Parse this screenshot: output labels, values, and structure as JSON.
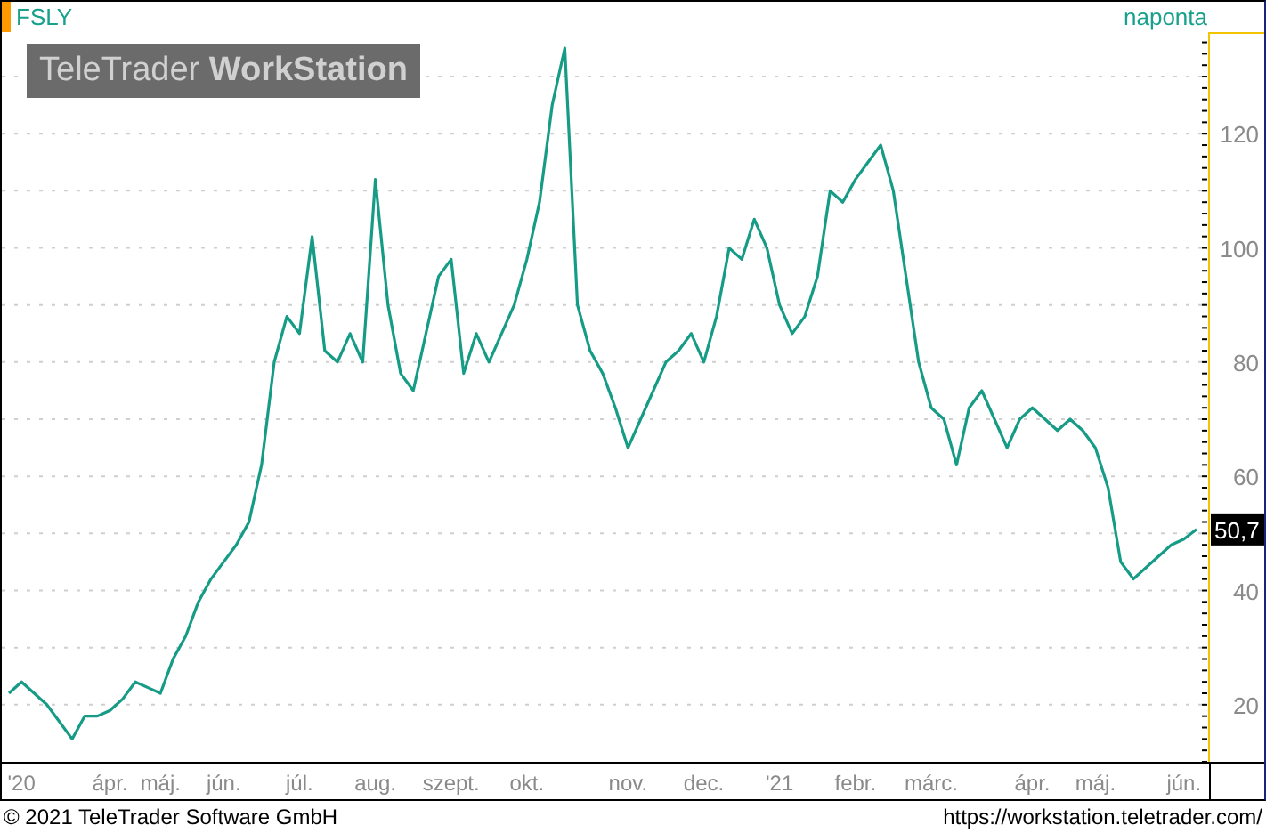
{
  "header": {
    "symbol": "FSLY",
    "interval": "naponta"
  },
  "logo": {
    "text": "TeleTrader **WorkStation**"
  },
  "chart": {
    "last_price": "50,7",
    "chart_data": {
      "type": "line",
      "categories": [
        null,
        "'20",
        null,
        null,
        null,
        null,
        null,
        null,
        "ápr.",
        null,
        null,
        null,
        "máj.",
        null,
        null,
        null,
        null,
        "jún.",
        null,
        null,
        null,
        null,
        null,
        "júl.",
        null,
        null,
        null,
        null,
        null,
        "aug.",
        null,
        null,
        null,
        null,
        null,
        "szept.",
        null,
        null,
        null,
        null,
        null,
        "okt.",
        null,
        null,
        null,
        null,
        null,
        null,
        null,
        "nov.",
        null,
        null,
        null,
        null,
        null,
        "dec.",
        null,
        null,
        null,
        null,
        null,
        "'21",
        null,
        null,
        null,
        null,
        null,
        "febr.",
        null,
        null,
        null,
        null,
        null,
        "márc.",
        null,
        null,
        null,
        null,
        null,
        null,
        null,
        "ápr.",
        null,
        null,
        null,
        null,
        "máj.",
        null,
        null,
        null,
        null,
        null,
        null,
        "jún.",
        null
      ],
      "series": [
        {
          "color": "#169c86",
          "values": [
            22,
            24,
            22,
            20,
            17,
            14,
            18,
            18,
            19,
            21,
            24,
            23,
            22,
            28,
            32,
            38,
            42,
            45,
            48,
            52,
            62,
            80,
            88,
            85,
            102,
            82,
            80,
            85,
            80,
            112,
            90,
            78,
            75,
            85,
            95,
            98,
            78,
            85,
            80,
            85,
            90,
            98,
            108,
            125,
            135,
            90,
            82,
            78,
            72,
            65,
            70,
            75,
            80,
            82,
            85,
            80,
            88,
            100,
            98,
            105,
            100,
            90,
            85,
            88,
            95,
            110,
            108,
            112,
            115,
            118,
            110,
            95,
            80,
            72,
            70,
            62,
            72,
            75,
            70,
            65,
            70,
            72,
            70,
            68,
            70,
            68,
            65,
            58,
            45,
            42,
            44,
            46,
            48,
            49,
            50.7
          ]
        }
      ],
      "grid": true,
      "ylim": [
        10,
        137.8
      ],
      "yticks": [
        {
          "value": 20,
          "label": "20"
        },
        {
          "value": 40,
          "label": "40"
        },
        {
          "value": 60,
          "label": "60"
        },
        {
          "value": 80,
          "label": "80"
        },
        {
          "value": 100,
          "label": "100"
        },
        {
          "value": 120,
          "label": "120"
        }
      ]
    }
  },
  "footer": {
    "copyright": "© 2021 TeleTrader Software GmbH",
    "url": "https://workstation.teletrader.com/"
  }
}
